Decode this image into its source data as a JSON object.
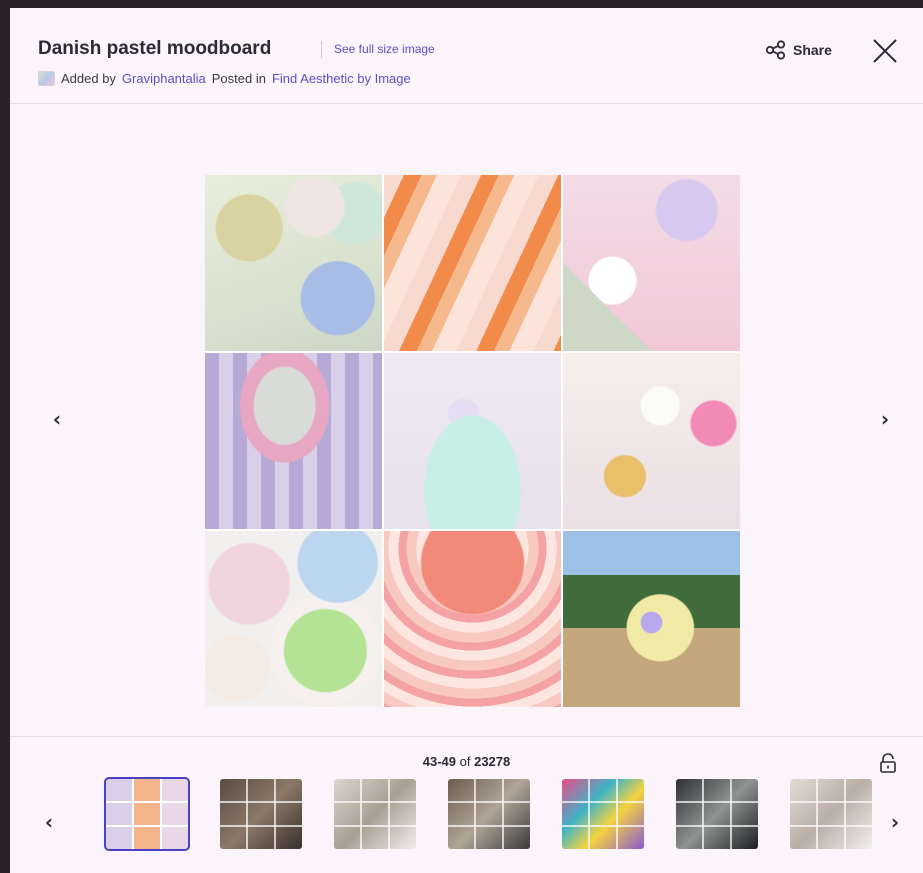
{
  "header": {
    "title": "Danish pastel moodboard",
    "see_full_size": "See full size image",
    "added_by_prefix": "Added by",
    "author": "Graviphantalia",
    "posted_in_prefix": "Posted in",
    "collection": "Find Aesthetic by Image",
    "share_label": "Share"
  },
  "icons": {
    "share": "share-icon",
    "close": "close-icon",
    "prev": "chevron-left-icon",
    "next": "chevron-right-icon",
    "lock": "unlock-icon"
  },
  "footer": {
    "range": "43-49",
    "of_label": "of",
    "total": "23278"
  },
  "colors": {
    "accent": "#5a4fc4",
    "background": "#fbf4fb",
    "text": "#2b2b33"
  }
}
